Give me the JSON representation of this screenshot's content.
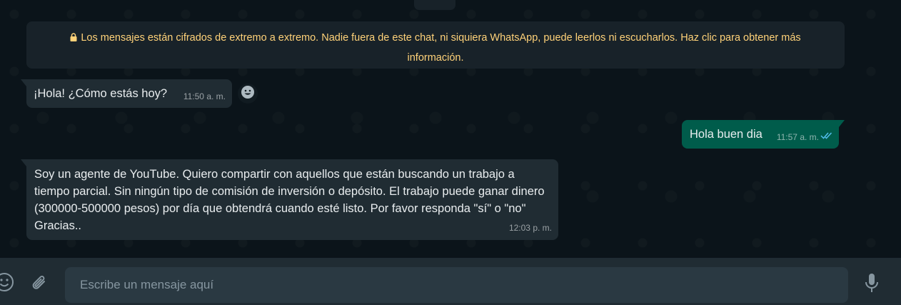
{
  "encryption_notice": "Los mensajes están cifrados de extremo a extremo. Nadie fuera de este chat, ni siquiera WhatsApp, puede leerlos ni escucharlos. Haz clic para obtener más información.",
  "messages": [
    {
      "direction": "incoming",
      "text": "¡Hola! ¿Cómo estás hoy?",
      "time": "11:50 a. m."
    },
    {
      "direction": "outgoing",
      "text": "Hola buen dia",
      "time": "11:57 a. m.",
      "status": "read"
    },
    {
      "direction": "incoming",
      "text": "Soy un agente de YouTube. Quiero compartir con aquellos que están buscando un trabajo a tiempo parcial. Sin ningún tipo de comisión de inversión o depósito. El trabajo puede ganar dinero (300000-500000 pesos) por día que obtendrá cuando esté listo. Por favor responda \"sí\" o \"no\" Gracias..",
      "time": "12:03 p. m."
    }
  ],
  "composer": {
    "placeholder": "Escribe un mensaje aquí",
    "value": ""
  },
  "icons": {
    "lock": "lock-icon",
    "react": "emoji-icon",
    "read_receipt": "double-check-icon",
    "emoji": "emoji-icon",
    "attach": "paperclip-icon",
    "mic": "microphone-icon"
  },
  "colors": {
    "background": "#0b141a",
    "incoming_bubble": "#202c33",
    "outgoing_bubble": "#005c4b",
    "notice_text": "#ffd279",
    "read_tick": "#53bdeb"
  }
}
